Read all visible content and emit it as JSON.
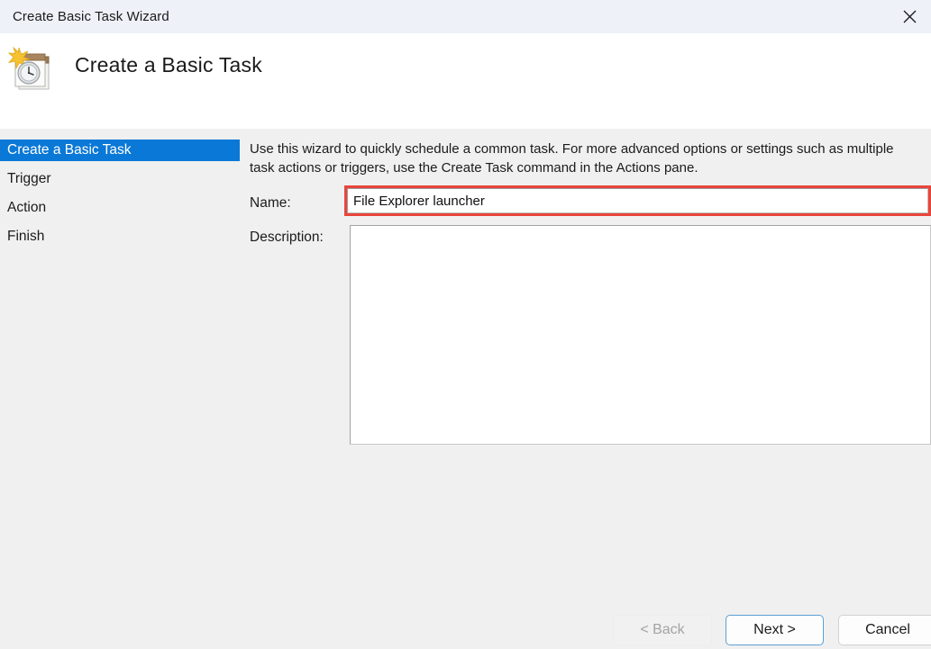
{
  "titlebar": {
    "title": "Create Basic Task Wizard",
    "close_icon": "close-icon"
  },
  "header": {
    "icon": "task-scheduler-calendar-clock-icon",
    "title": "Create a Basic Task"
  },
  "sidebar": {
    "items": [
      {
        "label": "Create a Basic Task",
        "selected": true
      },
      {
        "label": "Trigger",
        "selected": false
      },
      {
        "label": "Action",
        "selected": false
      },
      {
        "label": "Finish",
        "selected": false
      }
    ]
  },
  "content": {
    "intro": "Use this wizard to quickly schedule a common task.  For more advanced options or settings such as multiple task actions or triggers, use the Create Task command in the Actions pane.",
    "name_label": "Name:",
    "name_value": "File Explorer launcher",
    "name_placeholder": "",
    "description_label": "Description:",
    "description_value": "",
    "description_placeholder": ""
  },
  "footer": {
    "back_label": "< Back",
    "next_label": "Next >",
    "cancel_label": "Cancel"
  },
  "colors": {
    "titlebar_bg": "#eef1f8",
    "selection_blue": "#0a78d6",
    "annotation_red": "#e8453c",
    "default_button_border": "#5a9fd4",
    "body_bg": "#f0f0f0"
  }
}
